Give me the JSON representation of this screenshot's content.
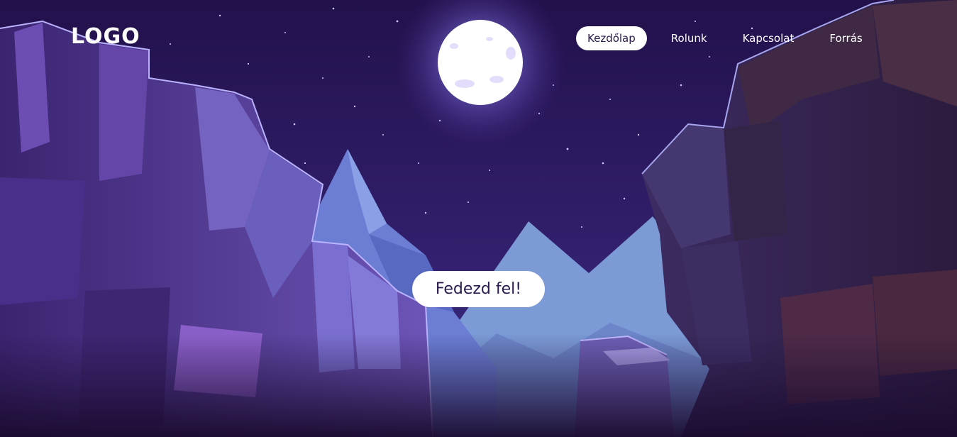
{
  "header": {
    "logo": "LOGO"
  },
  "nav": {
    "items": [
      {
        "label": "Kezdőlap",
        "active": true
      },
      {
        "label": "Rolunk",
        "active": false
      },
      {
        "label": "Kapcsolat",
        "active": false
      },
      {
        "label": "Forrás",
        "active": false
      }
    ]
  },
  "hero": {
    "cta_label": "Fedezd fel!"
  },
  "colors": {
    "sky_top": "#24134f",
    "sky_bottom": "#3a2a86",
    "moon": "#ffffff",
    "mountain_far": "#7b9ad6",
    "rock_left": "#5d3f99",
    "rock_right": "#3b2a5a",
    "button_bg": "#ffffff",
    "button_text": "#2b1a4f"
  }
}
